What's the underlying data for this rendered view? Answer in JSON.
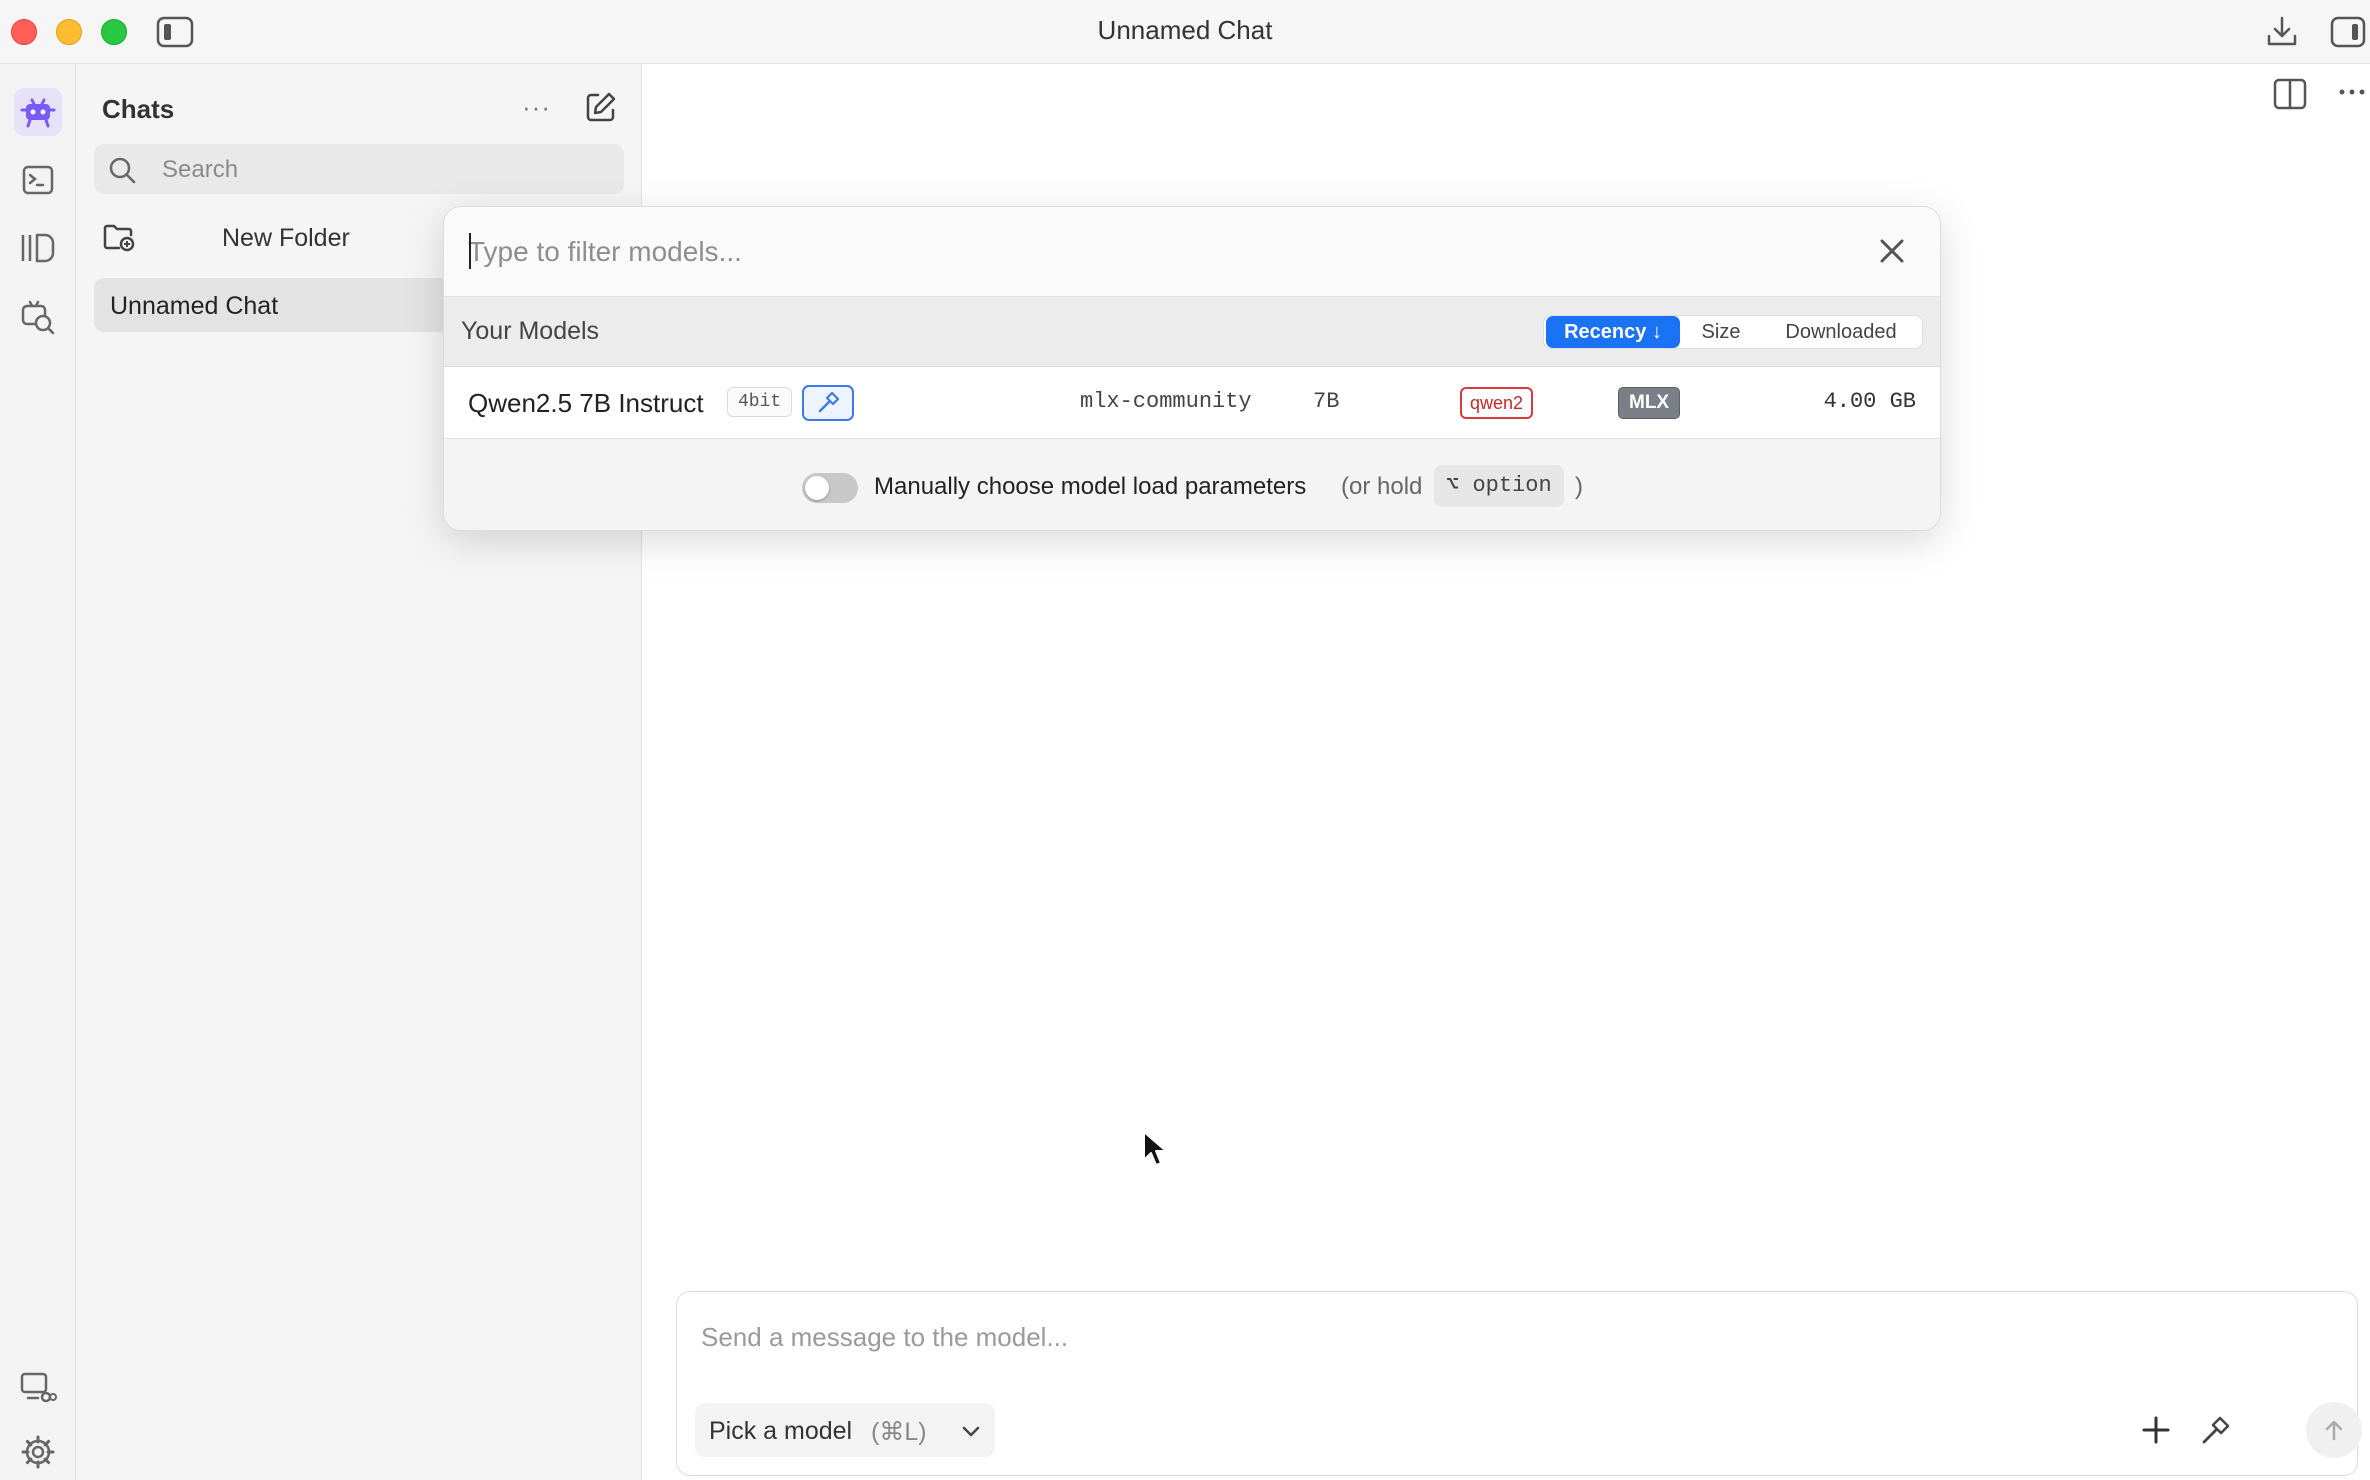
{
  "window": {
    "title": "Unnamed Chat"
  },
  "rail": {
    "icons": [
      "chat-robot-icon",
      "terminal-icon",
      "models-library-icon",
      "model-search-icon",
      "connection-icon",
      "settings-gear-icon"
    ]
  },
  "sidebar": {
    "title": "Chats",
    "more_label": "···",
    "search_placeholder": "Search",
    "new_folder_label": "New Folder",
    "chats": [
      {
        "label": "Unnamed Chat"
      }
    ]
  },
  "model_picker": {
    "filter_placeholder": "Type to filter models...",
    "section_title": "Your Models",
    "sort_options": [
      {
        "label": "Recency ↓",
        "active": true
      },
      {
        "label": "Size",
        "active": false
      },
      {
        "label": "Downloaded",
        "active": false
      }
    ],
    "models": [
      {
        "name": "Qwen2.5 7B Instruct",
        "quantization": "4bit",
        "publisher": "mlx-community",
        "params": "7B",
        "arch": "qwen2",
        "format": "MLX",
        "size": "4.00 GB"
      }
    ],
    "footer": {
      "toggle_label": "Manually choose model load parameters",
      "hint_prefix": "(or hold",
      "hint_key": "⌥ option",
      "hint_suffix": ")"
    }
  },
  "composer": {
    "placeholder": "Send a message to the model...",
    "model_button_label": "Pick a model",
    "model_button_shortcut": "(⌘L)"
  },
  "colors": {
    "accent": "#1a73f5",
    "arch_badge": "#d93a3a",
    "format_badge": "#7b8088",
    "rail_active": "#7a5af8"
  }
}
